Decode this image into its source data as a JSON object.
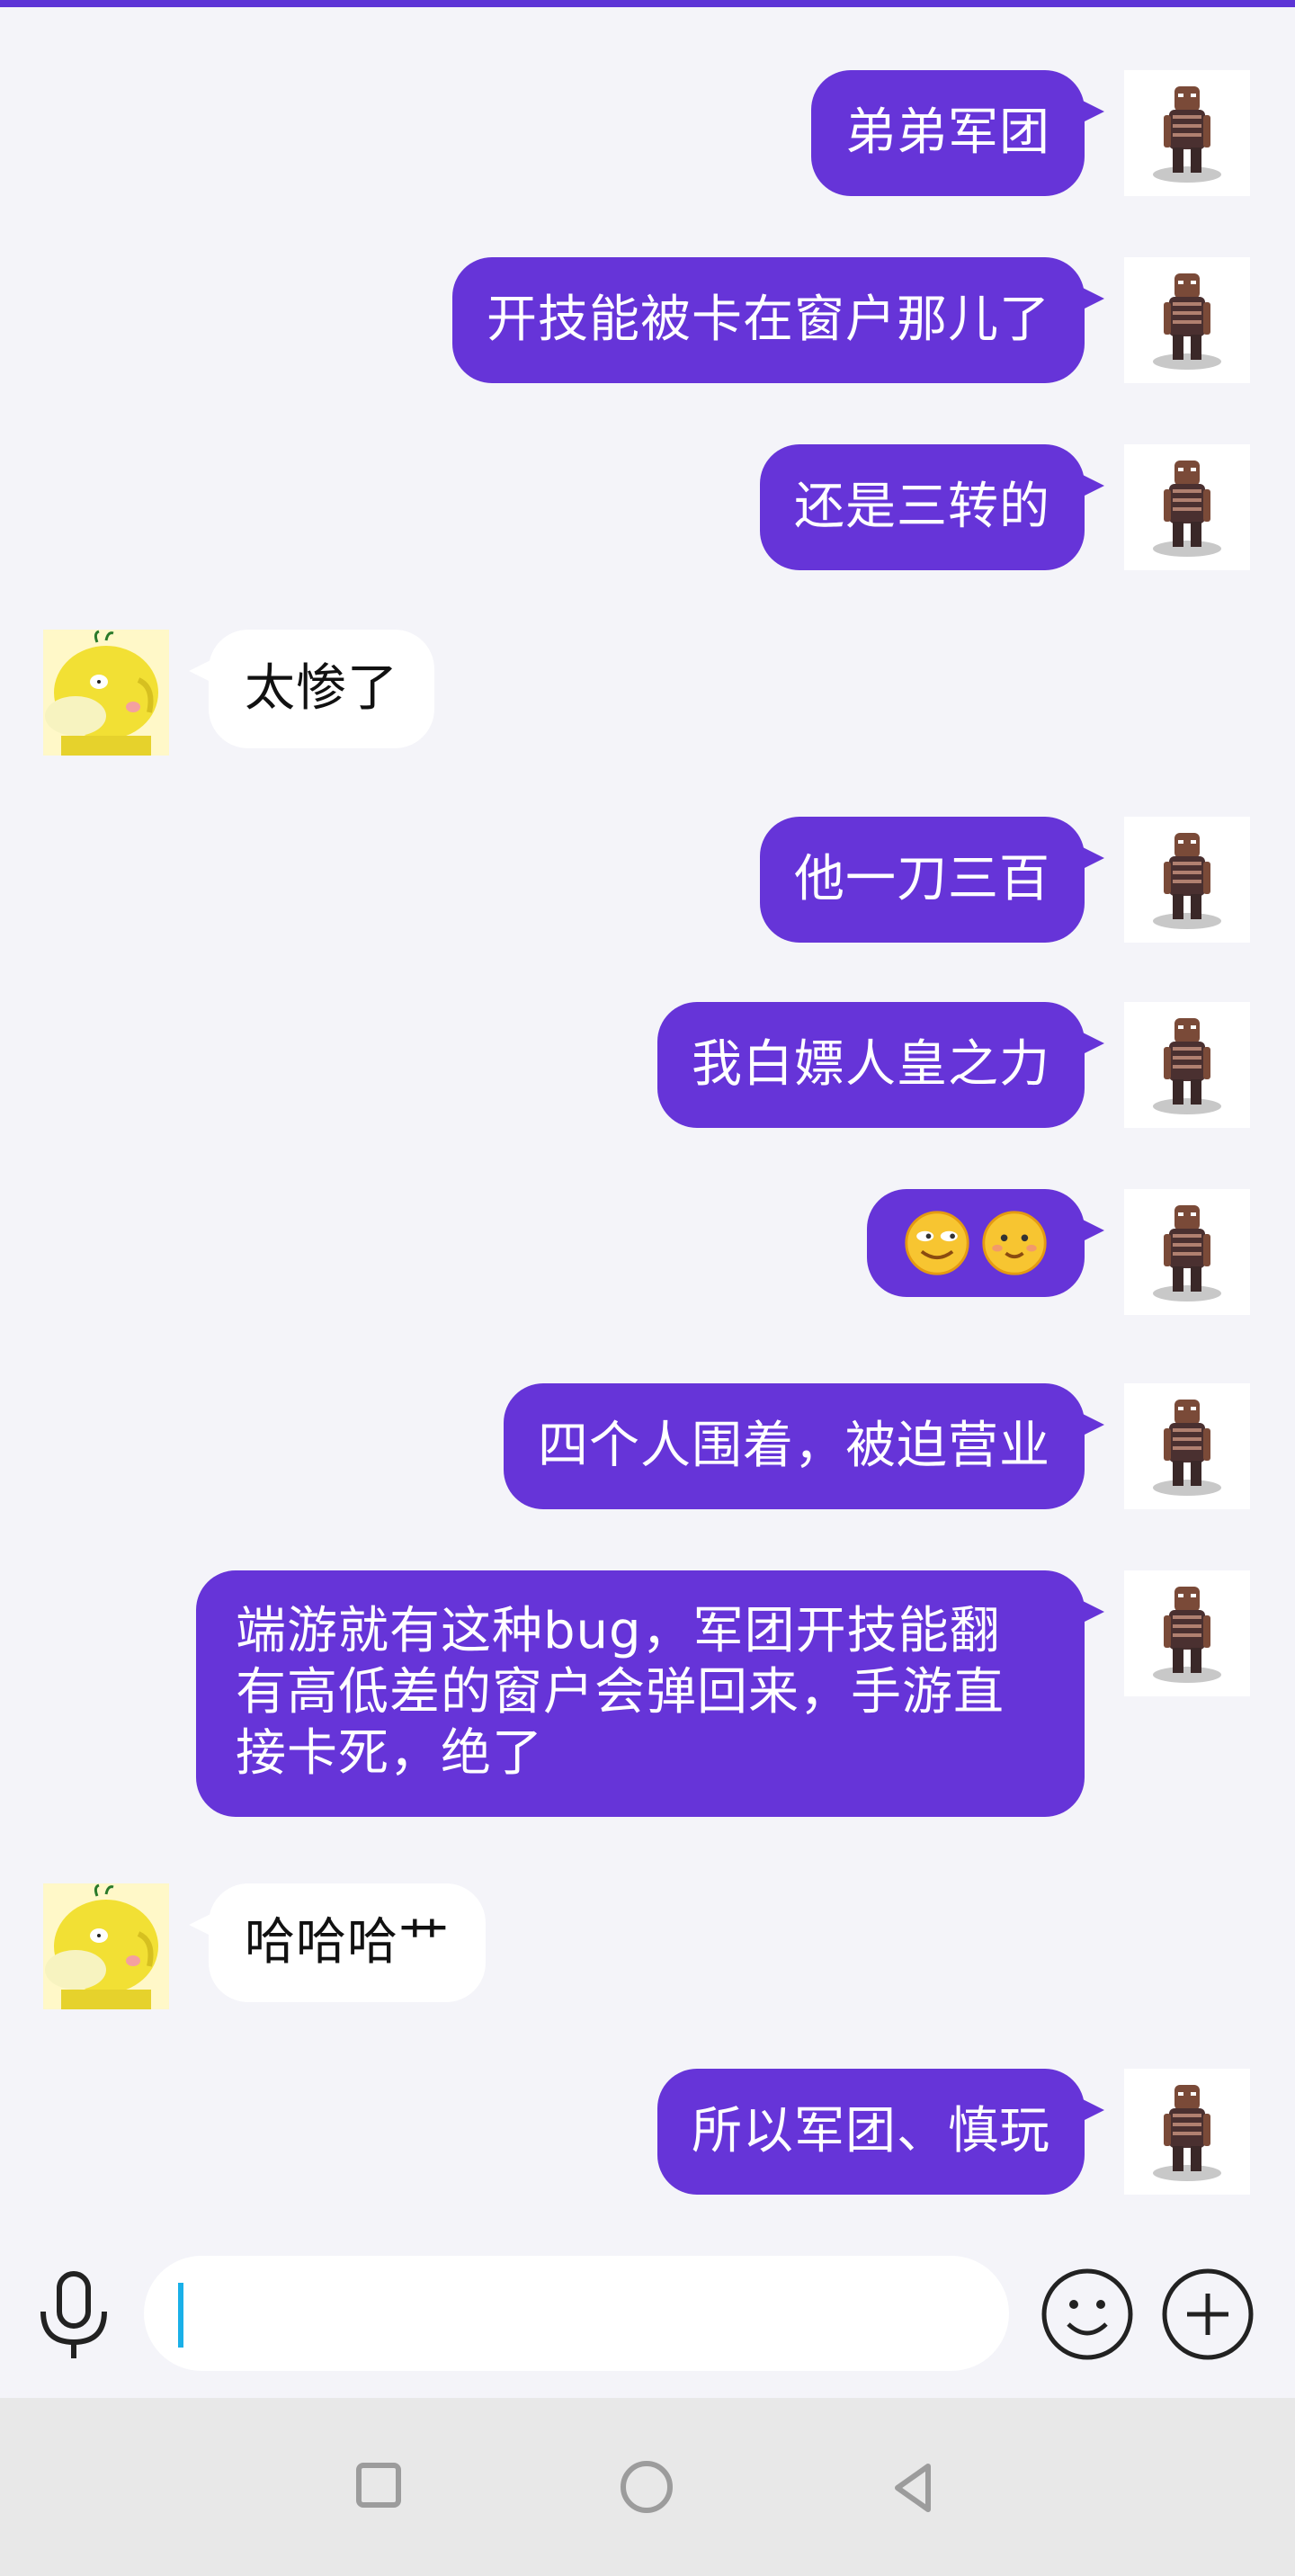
{
  "colors": {
    "accent": "#6634d8",
    "top_bar": "#5c34d6",
    "background": "#f4f4f9",
    "received_bubble": "#ffffff",
    "caret": "#1ab0e8",
    "nav_bar": "#e8e8e8"
  },
  "messages": [
    {
      "sender": "me",
      "text": "弟弟军团"
    },
    {
      "sender": "me",
      "text": "开技能被卡在窗户那儿了"
    },
    {
      "sender": "me",
      "text": "还是三转的"
    },
    {
      "sender": "other",
      "text": "太惨了"
    },
    {
      "sender": "me",
      "text": "他一刀三百"
    },
    {
      "sender": "me",
      "text": "我白嫖人皇之力"
    },
    {
      "sender": "me",
      "emoji": [
        "sly-smile-emoji",
        "smile-emoji"
      ]
    },
    {
      "sender": "me",
      "text": "四个人围着，被迫营业"
    },
    {
      "sender": "me",
      "text": "端游就有这种bug，军团开技能翻有高低差的窗户会弹回来，手游直接卡死，绝了"
    },
    {
      "sender": "other",
      "text": "哈哈哈艹"
    },
    {
      "sender": "me",
      "text": "所以军团、慎玩"
    }
  ],
  "input": {
    "value": "",
    "placeholder": ""
  },
  "icons": {
    "voice": "microphone-icon",
    "emoji": "smiley-icon",
    "more": "plus-icon",
    "nav_recent": "square-icon",
    "nav_home": "circle-icon",
    "nav_back": "triangle-back-icon",
    "my_avatar": "pixel-character-avatar",
    "other_avatar": "yellow-duck-avatar"
  }
}
